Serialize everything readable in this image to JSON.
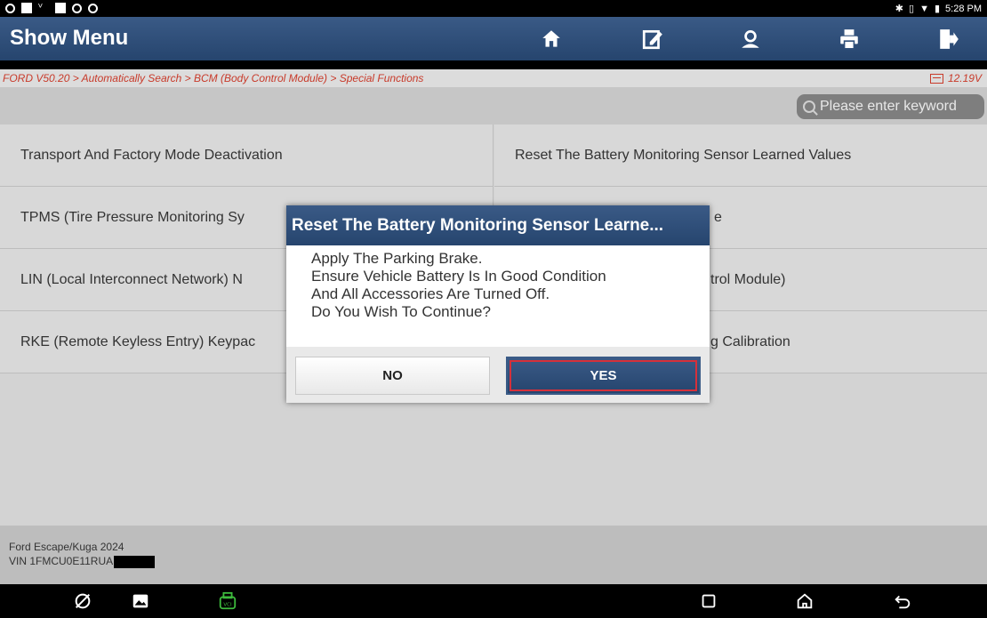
{
  "status_bar": {
    "time": "5:28 PM"
  },
  "titlebar": {
    "title": "Show Menu",
    "buttons": [
      "home-icon",
      "edit-report-icon",
      "user-icon",
      "print-icon",
      "exit-icon"
    ]
  },
  "breadcrumb": {
    "path": "FORD V50.20 > Automatically Search > BCM (Body Control Module) > Special Functions",
    "voltage": "12.19V"
  },
  "search": {
    "placeholder": "Please enter keyword"
  },
  "menu": {
    "items": [
      "Transport And Factory Mode Deactivation",
      "Reset The Battery Monitoring Sensor Learned Values",
      "TPMS (Tire Pressure Monitoring Sy",
      "e",
      "LIN (Local Interconnect Network) N",
      "trol Module)",
      "RKE (Remote Keyless Entry) Keypac",
      "g Calibration"
    ]
  },
  "dialog": {
    "title": "Reset The Battery Monitoring Sensor Learne...",
    "lines": [
      "Apply The Parking Brake.",
      "Ensure Vehicle Battery Is In Good Condition",
      "And All Accessories Are Turned Off.",
      "Do You Wish To Continue?"
    ],
    "no_label": "NO",
    "yes_label": "YES"
  },
  "vehicle": {
    "model": "Ford Escape/Kuga 2024",
    "vin_prefix": "VIN 1FMCU0E11RUA"
  },
  "colors": {
    "titlebar": "#2f4f7a",
    "breadcrumb_text": "#c83a2a",
    "highlight": "#d6303a"
  }
}
